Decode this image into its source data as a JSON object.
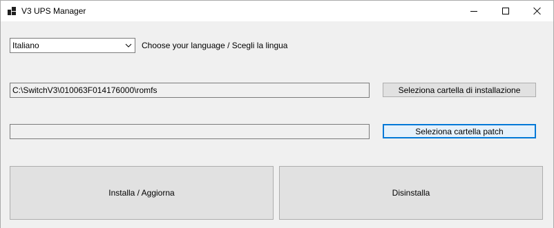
{
  "window": {
    "title": "V3 UPS Manager"
  },
  "language": {
    "selected": "Italiano",
    "label": "Choose your language / Scegli la lingua"
  },
  "install_folder": {
    "path": "C:\\SwitchV3\\010063F014176000\\romfs",
    "button_label": "Seleziona cartella di installazione"
  },
  "patch_folder": {
    "path": "",
    "button_label": "Seleziona cartella patch"
  },
  "actions": {
    "install_label": "Installa / Aggiorna",
    "uninstall_label": "Disinstalla"
  },
  "colors": {
    "focus_accent": "#0078d7",
    "window_bg": "#f0f0f0",
    "button_bg": "#e1e1e1"
  }
}
